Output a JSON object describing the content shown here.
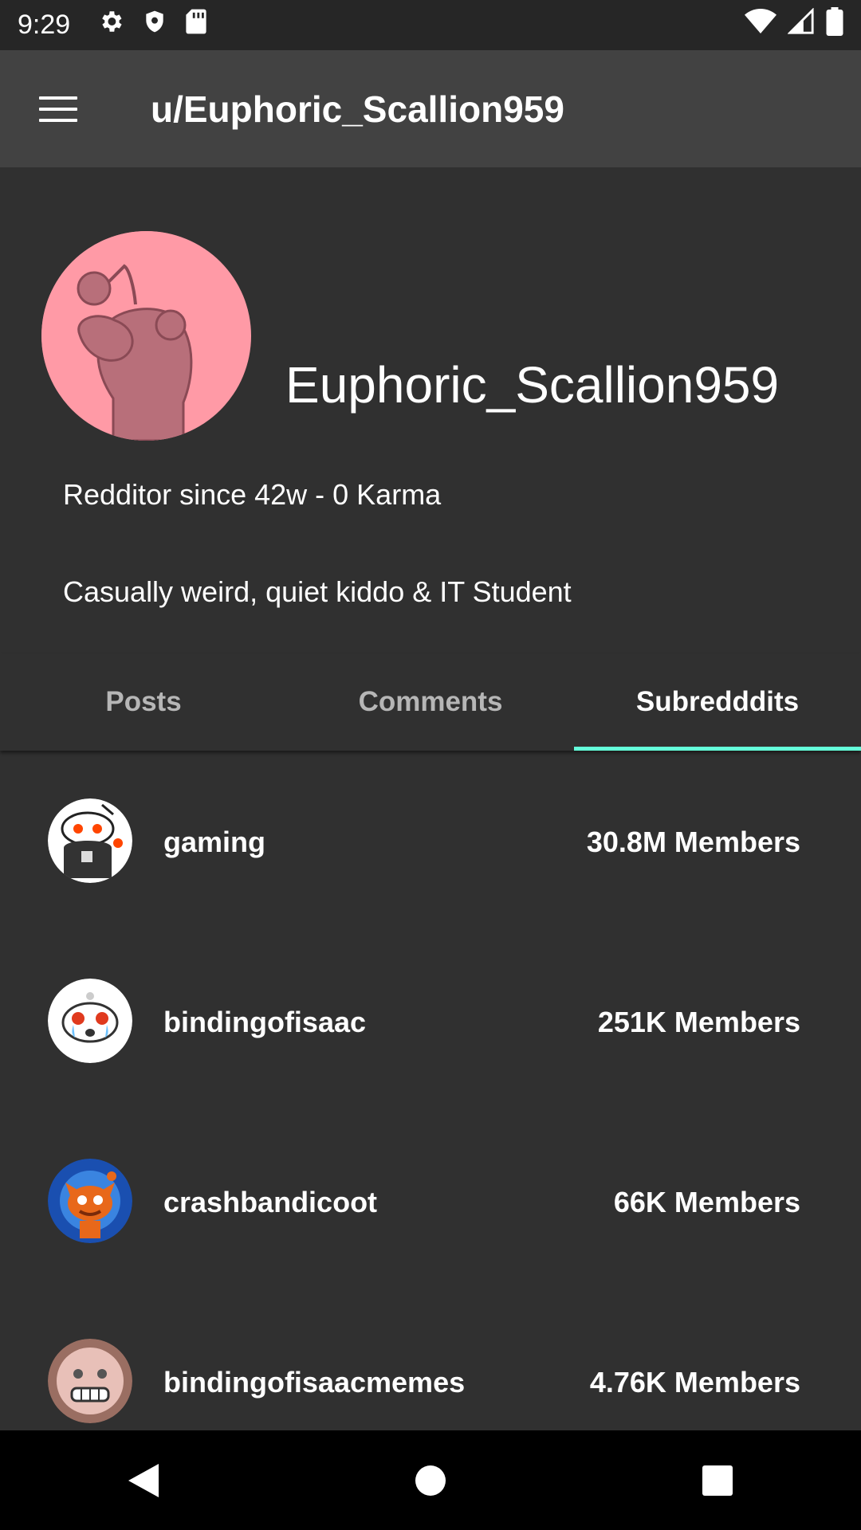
{
  "status_bar": {
    "time": "9:29",
    "icons_left": [
      "gear-icon",
      "shield-icon",
      "sd-card-icon"
    ],
    "icons_right": [
      "wifi-icon",
      "signal-icon",
      "battery-icon"
    ]
  },
  "app_bar": {
    "menu_icon": "menu-icon",
    "title": "u/Euphoric_Scallion959"
  },
  "profile": {
    "avatar_color": "#ff9aa6",
    "username": "Euphoric_Scallion959",
    "since": "Redditor since 42w - 0 Karma",
    "bio": "Casually weird, quiet kiddo & IT Student"
  },
  "tabs": [
    {
      "label": "Posts",
      "active": false
    },
    {
      "label": "Comments",
      "active": false
    },
    {
      "label": "Subredddits",
      "active": true
    }
  ],
  "accent_color": "#64ffda",
  "subreddits": [
    {
      "name": "gaming",
      "members": "30.8M Members"
    },
    {
      "name": "bindingofisaac",
      "members": "251K Members"
    },
    {
      "name": "crashbandicoot",
      "members": "66K Members"
    },
    {
      "name": "bindingofisaacmemes",
      "members": "4.76K Members"
    }
  ],
  "nav_bar": [
    "back-icon",
    "home-icon",
    "recents-icon"
  ]
}
